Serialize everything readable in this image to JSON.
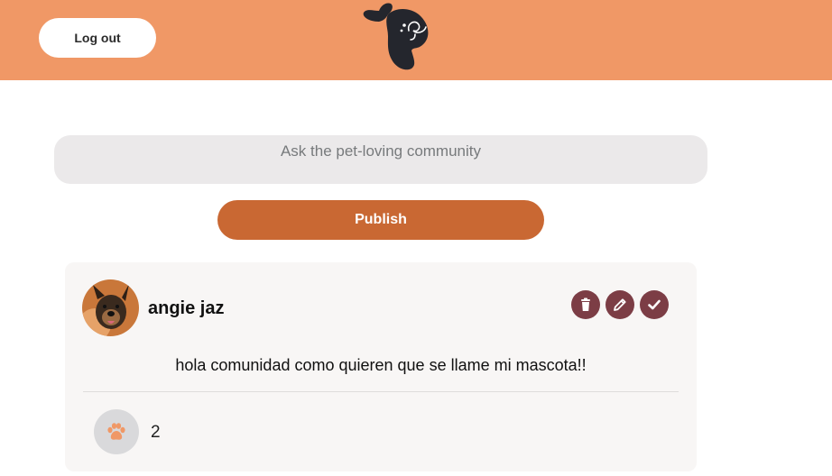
{
  "header": {
    "logout_label": "Log out",
    "logo_icon": "dog-head-logo",
    "background_color": "#f09866"
  },
  "composer": {
    "placeholder": "Ask the pet-loving community",
    "value": "",
    "publish_label": "Publish",
    "publish_color": "#c96833"
  },
  "post": {
    "author": "angie jaz",
    "avatar_icon": "dog-photo-avatar",
    "text": "hola comunidad como quieren que se llame mi mascota!!",
    "actions": [
      {
        "name": "delete",
        "icon": "trash-icon"
      },
      {
        "name": "edit",
        "icon": "pencil-icon"
      },
      {
        "name": "save",
        "icon": "check-icon"
      }
    ],
    "action_color": "#7c3d45",
    "likes": {
      "icon": "paw-icon",
      "count": "2"
    }
  }
}
